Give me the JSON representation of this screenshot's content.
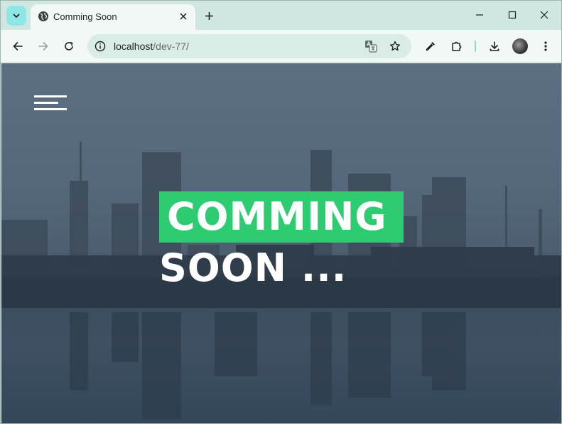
{
  "browser": {
    "tab": {
      "title": "Comming Soon"
    },
    "address": {
      "host": "localhost",
      "path": "/dev-77/"
    }
  },
  "page": {
    "headline_line1": "COMMING",
    "headline_line2": "SOON ...",
    "colors": {
      "accent": "#2ecc71",
      "overlay": "#55677a",
      "text": "#ffffff"
    }
  },
  "icons": {
    "tab_menu": "chevron-down-icon",
    "favicon": "globe-icon",
    "tab_close": "close-icon",
    "new_tab": "plus-icon",
    "minimize": "minimize-icon",
    "maximize": "maximize-icon",
    "close_window": "close-icon",
    "back": "arrow-left-icon",
    "forward": "arrow-right-icon",
    "reload": "reload-icon",
    "site_info": "info-icon",
    "translate": "translate-icon",
    "bookmark": "star-icon",
    "eyedropper": "eyedropper-icon",
    "extensions": "puzzle-icon",
    "download": "download-icon",
    "menu": "more-vert-icon",
    "hamburger": "hamburger-menu-icon"
  }
}
